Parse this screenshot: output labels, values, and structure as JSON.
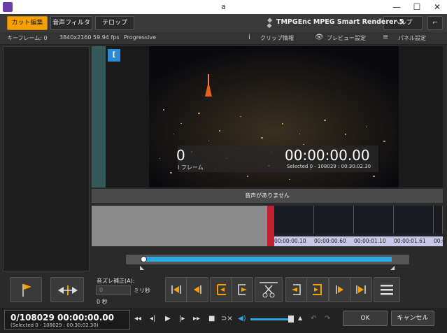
{
  "window": {
    "title": "a",
    "minimize": "—",
    "maximize": "☐",
    "close": "✕"
  },
  "toolbar": {
    "tabs": [
      {
        "label": "カット編集",
        "active": true
      },
      {
        "label": "音声フィルター",
        "active": false
      },
      {
        "label": "テロップ",
        "active": false
      }
    ],
    "brand": "TMPGEnc MPEG Smart Renderer 5",
    "help_label": "ヘルプ"
  },
  "infobar": {
    "keyframe": "キーフレーム: 0",
    "resolution": "3840x2160 59.94 fps",
    "scan": "Progressive",
    "clip_info": "クリップ情報",
    "preview_settings": "プレビュー設定",
    "panel_settings": "パネル設定"
  },
  "preview": {
    "marker": "[",
    "frame_number": "0",
    "frame_type": "I フレーム",
    "timecode": "00:00:00.00",
    "selected": "Selected 0 - 108029 : 00:30:02.30"
  },
  "audio": {
    "no_audio": "音声がありません"
  },
  "timeline": {
    "thumb_times": [
      "00:00:00.10",
      "00:00:00.60",
      "00:00:01.10",
      "00:00:01.61",
      "00:00"
    ]
  },
  "offset": {
    "label": "音ズレ補正(A):",
    "value": "0",
    "unit": "ミリ秒",
    "display": "0 秒"
  },
  "status": {
    "position": "0/108029 00:00:00.00",
    "selected": "(Selected 0 - 108029 : 00:30:02.30)"
  },
  "buttons": {
    "ok": "OK",
    "cancel": "キャンセル"
  },
  "colors": {
    "accent": "#f5a000",
    "blue": "#2aa8e0",
    "purple": "#6a3ea8"
  }
}
